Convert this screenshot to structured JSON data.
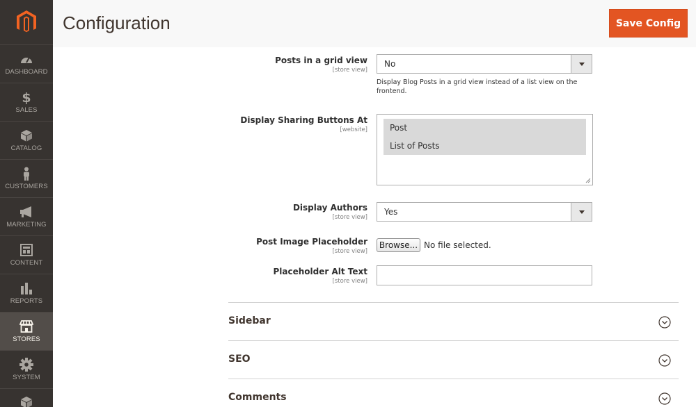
{
  "sidebar": {
    "logo": "magento-logo",
    "items": [
      {
        "label": "DASHBOARD",
        "icon": "dashboard-icon"
      },
      {
        "label": "SALES",
        "icon": "dollar-icon"
      },
      {
        "label": "CATALOG",
        "icon": "cube-icon"
      },
      {
        "label": "CUSTOMERS",
        "icon": "person-icon"
      },
      {
        "label": "MARKETING",
        "icon": "megaphone-icon"
      },
      {
        "label": "CONTENT",
        "icon": "layout-icon"
      },
      {
        "label": "REPORTS",
        "icon": "bar-chart-icon"
      },
      {
        "label": "STORES",
        "icon": "storefront-icon",
        "active": true
      },
      {
        "label": "SYSTEM",
        "icon": "gear-icon"
      },
      {
        "label": "",
        "icon": "extensions-icon"
      }
    ]
  },
  "header": {
    "title": "Configuration",
    "save_label": "Save Config"
  },
  "form": {
    "grid_view": {
      "label": "Posts in a grid view",
      "scope": "[store view]",
      "value": "No",
      "note": "Display Blog Posts in a grid view instead of a list view on the frontend."
    },
    "sharing": {
      "label": "Display Sharing Buttons At",
      "scope": "[website]",
      "options": [
        "Post",
        "List of Posts"
      ]
    },
    "authors": {
      "label": "Display Authors",
      "scope": "[store view]",
      "value": "Yes"
    },
    "placeholder": {
      "label": "Post Image Placeholder",
      "scope": "[store view]",
      "browse_label": "Browse...",
      "file_status": "No file selected."
    },
    "alt_text": {
      "label": "Placeholder Alt Text",
      "scope": "[store view]",
      "value": ""
    }
  },
  "sections": [
    {
      "title": "Sidebar"
    },
    {
      "title": "SEO"
    },
    {
      "title": "Comments"
    }
  ],
  "colors": {
    "accent": "#e35522",
    "sidebar": "#373330"
  }
}
